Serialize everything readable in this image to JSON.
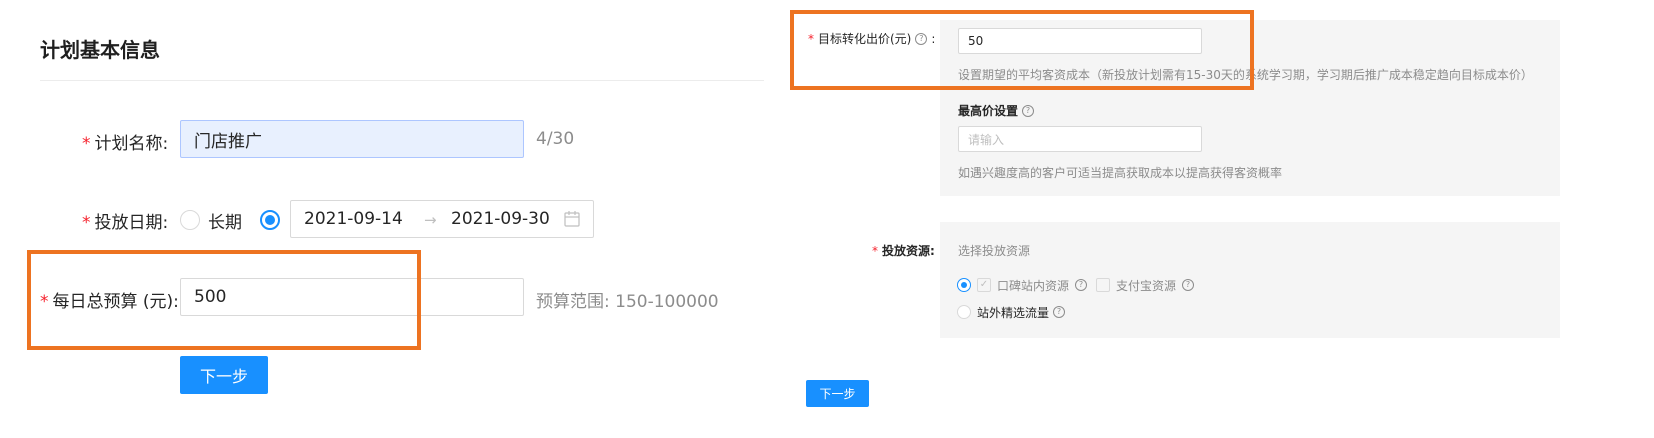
{
  "left": {
    "section_title": "计划基本信息",
    "plan_name": {
      "required": "*",
      "label": "计划名称:",
      "value": "门店推广",
      "counter": "4/30"
    },
    "dates": {
      "required": "*",
      "label": "投放日期:",
      "option_long": "长期",
      "start": "2021-09-14",
      "arrow": "→",
      "end": "2021-09-30",
      "calendar_icon": "calendar-icon"
    },
    "budget": {
      "required": "*",
      "label": "每日总预算 (元):",
      "value": "500",
      "range_text": "预算范围: 150-100000"
    },
    "next_label": "下一步"
  },
  "right": {
    "target_bid": {
      "required": "*",
      "label": "目标转化出价(元)",
      "colon": ":",
      "value": "50",
      "hint": "设置期望的平均客资成本（新投放计划需有15-30天的系统学习期，学习期后推广成本稳定趋向目标成本价）"
    },
    "max_bid": {
      "label": "最高价设置",
      "placeholder": "请输入",
      "hint": "如遇兴趣度高的客户可适当提高获取成本以提高获得客资概率"
    },
    "resources": {
      "required": "*",
      "label": "投放资源:",
      "title": "选择投放资源",
      "koubei": "口碑站内资源",
      "alipay": "支付宝资源",
      "offsite": "站外精选流量"
    },
    "next_label": "下一步"
  },
  "colors": {
    "primary": "#1890ff",
    "highlight": "#ed7321",
    "required": "#f5222d"
  }
}
